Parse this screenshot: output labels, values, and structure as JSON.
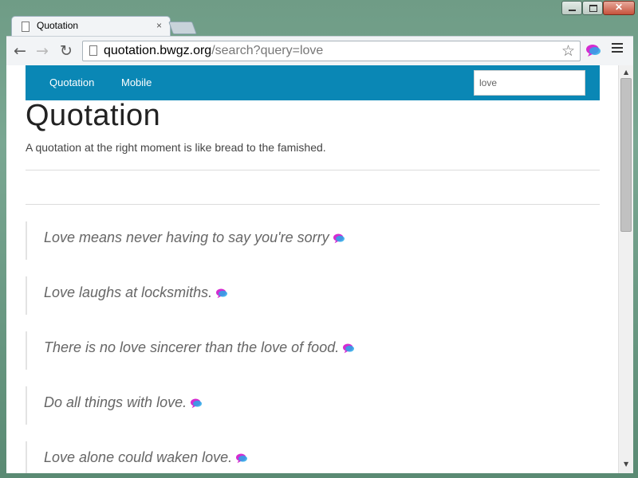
{
  "browser": {
    "tab_title": "Quotation",
    "tab_close": "×",
    "url_host": "quotation.bwgz.org",
    "url_path": "/search?query=love"
  },
  "site": {
    "nav": [
      "Quotation",
      "Mobile"
    ],
    "search_value": "love",
    "title": "Quotation",
    "tagline": "A quotation at the right moment is like bread to the famished."
  },
  "quotes": [
    "Love means never having to say you're sorry",
    "Love laughs at locksmiths.",
    "There is no love sincerer than the love of food.",
    "Do all things with love.",
    "Love alone could waken love."
  ],
  "colors": {
    "navbar": "#0a87b5",
    "bubble_pink": "#d42cd0",
    "bubble_blue": "#29a8e8"
  },
  "icons": [
    "page-icon",
    "back-arrow-icon",
    "forward-arrow-icon",
    "reload-icon",
    "star-icon",
    "chat-bubble-icon",
    "menu-icon"
  ]
}
